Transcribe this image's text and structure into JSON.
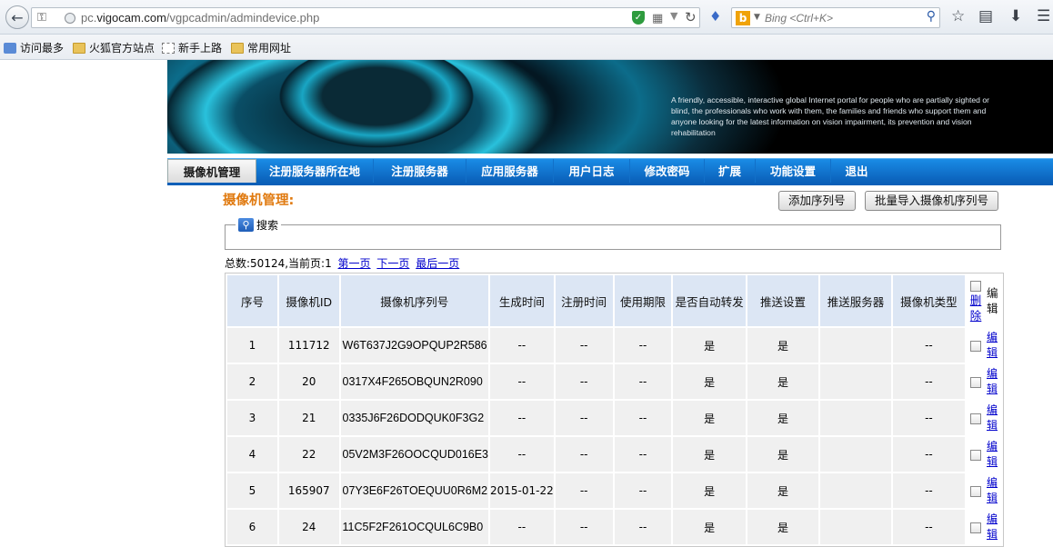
{
  "browser": {
    "url_prefix": "pc.",
    "url_domain": "vigocam.com",
    "url_path": "/vgpcadmin/admindevice.php",
    "search_placeholder": "Bing  <Ctrl+K>",
    "bookmarks": [
      "访问最多",
      "火狐官方站点",
      "新手上路",
      "常用网址"
    ]
  },
  "banner": {
    "text": "A friendly, accessible, interactive global Internet portal for people who are partially sighted or blind, the professionals who work with them, the families and friends who support them and anyone looking for the latest information on vision impairment, its prevention and vision rehabilitation"
  },
  "nav": {
    "items": [
      "摄像机管理",
      "注册服务器所在地",
      "注册服务器",
      "应用服务器",
      "用户日志",
      "修改密码",
      "扩展",
      "功能设置",
      "退出"
    ],
    "active": "摄像机管理"
  },
  "section": {
    "title": "摄像机管理:",
    "add_serial_button": "添加序列号",
    "bulk_import_button": "批量导入摄像机序列号",
    "search_legend": "搜索"
  },
  "pager": {
    "summary": "总数:50124,当前页:1",
    "first": "第一页",
    "next": "下一页",
    "last": "最后一页"
  },
  "table": {
    "headers": [
      "序号",
      "摄像机ID",
      "摄像机序列号",
      "生成时间",
      "注册时间",
      "使用期限",
      "是否自动转发",
      "推送设置",
      "推送服务器",
      "摄像机类型",
      "删除",
      "编辑"
    ],
    "edit_link": "编辑",
    "rows": [
      {
        "no": "1",
        "id": "111712",
        "serial": "W6T637J2G9OPQUP2R586",
        "created": "--",
        "registered": "--",
        "term": "--",
        "auto_forward": "是",
        "push": "是",
        "push_server": "",
        "type": "--"
      },
      {
        "no": "2",
        "id": "20",
        "serial": "0317X4F265OBQUN2R090",
        "created": "--",
        "registered": "--",
        "term": "--",
        "auto_forward": "是",
        "push": "是",
        "push_server": "",
        "type": "--"
      },
      {
        "no": "3",
        "id": "21",
        "serial": "0335J6F26DODQUK0F3G2",
        "created": "--",
        "registered": "--",
        "term": "--",
        "auto_forward": "是",
        "push": "是",
        "push_server": "",
        "type": "--"
      },
      {
        "no": "4",
        "id": "22",
        "serial": "05V2M3F26OOCQUD016E3",
        "created": "--",
        "registered": "--",
        "term": "--",
        "auto_forward": "是",
        "push": "是",
        "push_server": "",
        "type": "--"
      },
      {
        "no": "5",
        "id": "165907",
        "serial": "07Y3E6F26TOEQUU0R6M2",
        "created": "2015-01-22",
        "registered": "--",
        "term": "--",
        "auto_forward": "是",
        "push": "是",
        "push_server": "",
        "type": "--"
      },
      {
        "no": "6",
        "id": "24",
        "serial": "11C5F2F261OCQUL6C9B0",
        "created": "--",
        "registered": "--",
        "term": "--",
        "auto_forward": "是",
        "push": "是",
        "push_server": "",
        "type": "--"
      }
    ]
  }
}
